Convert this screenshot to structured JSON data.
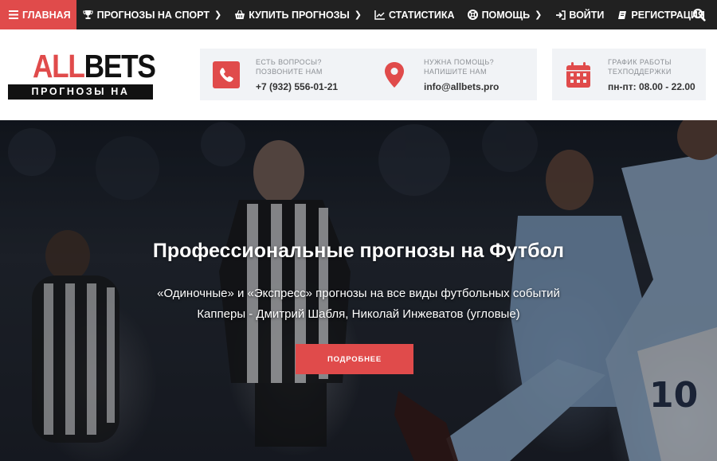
{
  "nav": {
    "items": [
      {
        "label": "ГЛАВНАЯ",
        "icon": "menu-icon",
        "active": true
      },
      {
        "label": "ПРОГНОЗЫ НА СПОРТ",
        "icon": "trophy-icon",
        "dropdown": true
      },
      {
        "label": "КУПИТЬ ПРОГНОЗЫ",
        "icon": "basket-icon",
        "dropdown": true
      },
      {
        "label": "СТАТИСТИКА",
        "icon": "chart-icon"
      },
      {
        "label": "ПОМОЩЬ",
        "icon": "lifebuoy-icon",
        "dropdown": true
      },
      {
        "label": "ВОЙТИ",
        "icon": "login-icon"
      },
      {
        "label": "РЕГИСТРАЦИЯ",
        "icon": "book-icon"
      }
    ],
    "search_icon": "search-icon"
  },
  "logo": {
    "word_red": "ALL",
    "word_dark": "BETS",
    "tagline": "ПРОГНОЗЫ НА СПОРТ"
  },
  "info": [
    {
      "icon": "phone-icon",
      "line1": "ЕСТЬ ВОПРОСЫ?",
      "line2": "ПОЗВОНИТЕ НАМ",
      "value": "+7 (932) 556-01-21"
    },
    {
      "icon": "map-pin-icon",
      "line1": "НУЖНА ПОМОЩЬ?",
      "line2": "НАПИШИТЕ НАМ",
      "value": "info@allbets.pro"
    },
    {
      "icon": "calendar-icon",
      "line1": "ГРАФИК РАБОТЫ",
      "line2": "ТЕХПОДДЕРЖКИ",
      "value": "пн-пт: 08.00 - 22.00"
    }
  ],
  "hero": {
    "title": "Профессиональные прогнозы на Футбол",
    "subtitle1": "«Одиночные» и «Экспресс» прогнозы на все виды футбольных событий",
    "subtitle2": "Капперы - Дмитрий Шабля, Николай Инжеватов (угловые)",
    "button": "ПОДРОБНЕЕ"
  },
  "colors": {
    "accent": "#e04b4b",
    "nav_bg": "#212121",
    "info_bg": "#f1f3f6"
  }
}
